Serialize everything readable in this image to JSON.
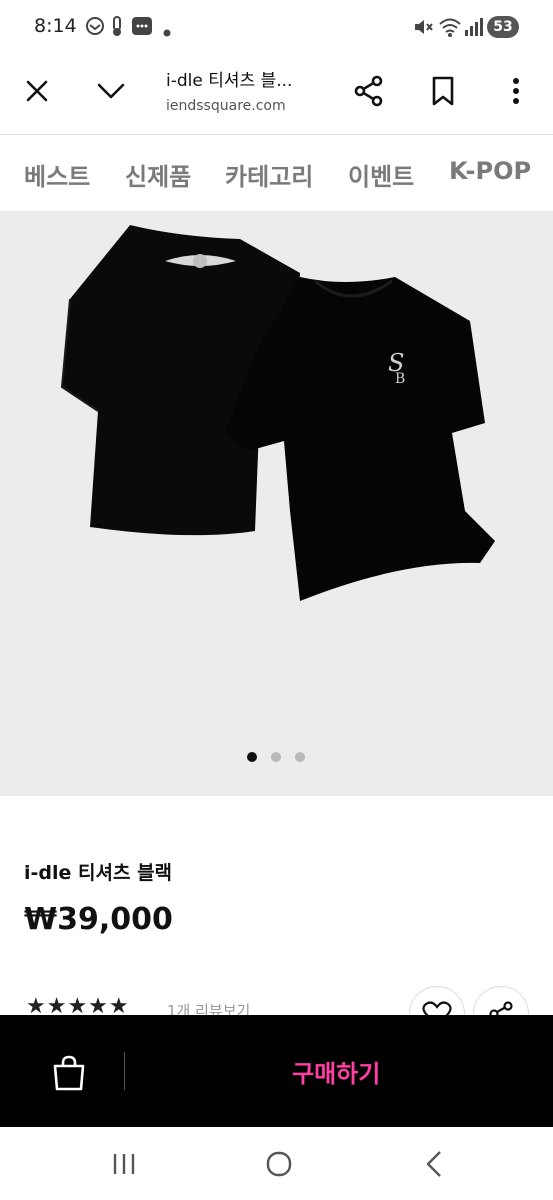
{
  "status_bar": {
    "time": "8:14",
    "battery": "53",
    "icons": [
      "mute-icon",
      "wifi-icon",
      "signal-icon"
    ]
  },
  "browser": {
    "page_title": "i-dle 티셔츠 블...",
    "page_url": "iendssquare.com",
    "buttons": [
      "close-icon",
      "chevron-down-icon",
      "share-icon",
      "bookmark-icon",
      "more-vertical-icon"
    ]
  },
  "category_nav": {
    "items": [
      {
        "label": "베스트"
      },
      {
        "label": "신제품"
      },
      {
        "label": "카테고리"
      },
      {
        "label": "이벤트"
      },
      {
        "label": "K-POP"
      }
    ]
  },
  "carousel": {
    "slide_count": 3,
    "active_index": 0
  },
  "product": {
    "name": "i-dle 티셔츠 블랙",
    "price": "₩39,000",
    "stars": "★★★★★",
    "review_link": "1개 리뷰보기"
  },
  "purchase_bar": {
    "buy_label": "구매하기"
  },
  "colors": {
    "accent": "#ff3fa4",
    "bar_bg": "#000000",
    "hero_bg": "#ececec",
    "category_text": "#7a7a7a"
  }
}
